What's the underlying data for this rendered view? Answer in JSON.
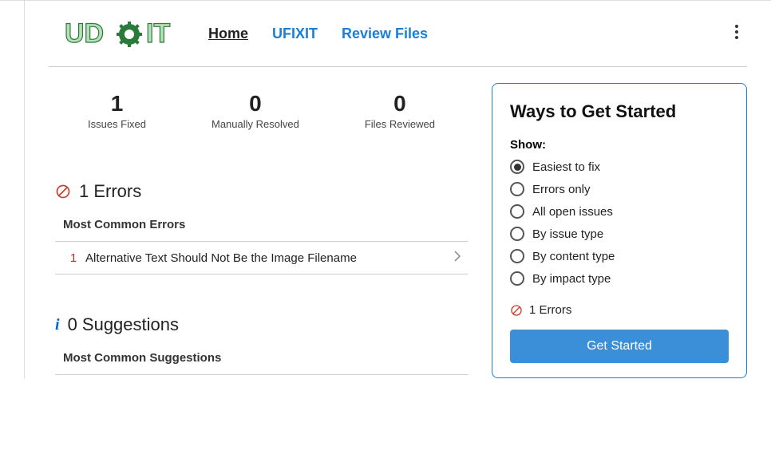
{
  "nav": {
    "home": "Home",
    "ufixit": "UFIXIT",
    "review_files": "Review Files"
  },
  "stats": {
    "fixed": {
      "value": "1",
      "label": "Issues Fixed"
    },
    "manual": {
      "value": "0",
      "label": "Manually Resolved"
    },
    "files": {
      "value": "0",
      "label": "Files Reviewed"
    }
  },
  "errors": {
    "heading": "1 Errors",
    "subhead": "Most Common Errors",
    "items": [
      {
        "count": "1",
        "title": "Alternative Text Should Not Be the Image Filename"
      }
    ]
  },
  "suggestions": {
    "heading": "0 Suggestions",
    "subhead": "Most Common Suggestions"
  },
  "panel": {
    "title": "Ways to Get Started",
    "show_label": "Show:",
    "options": [
      {
        "label": "Easiest to fix",
        "selected": true
      },
      {
        "label": "Errors only",
        "selected": false
      },
      {
        "label": "All open issues",
        "selected": false
      },
      {
        "label": "By issue type",
        "selected": false
      },
      {
        "label": "By content type",
        "selected": false
      },
      {
        "label": "By impact type",
        "selected": false
      }
    ],
    "errors_text": "1 Errors",
    "button": "Get Started"
  }
}
